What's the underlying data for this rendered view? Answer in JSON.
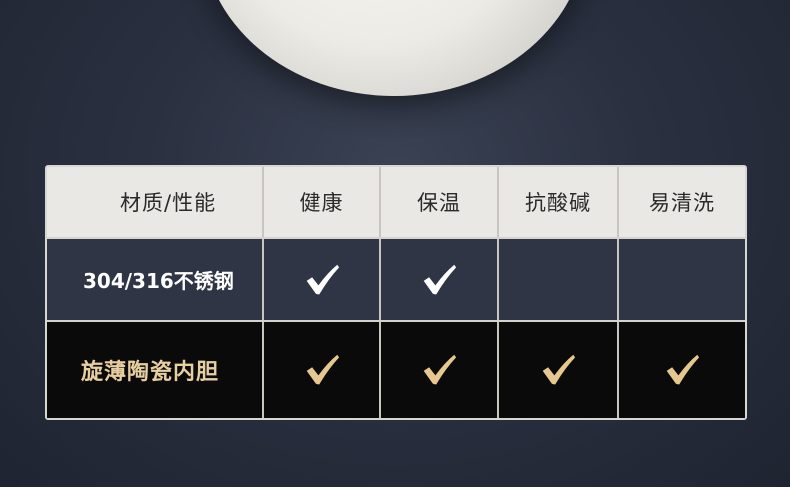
{
  "table": {
    "header": {
      "category": "材质/性能",
      "columns": [
        "健康",
        "保温",
        "抗酸碱",
        "易清洗"
      ]
    },
    "rows": [
      {
        "label": "304/316不锈钢",
        "checks": [
          true,
          true,
          false,
          false
        ],
        "check_color": "#ffffff"
      },
      {
        "label": "旋薄陶瓷内胆",
        "checks": [
          true,
          true,
          true,
          true
        ],
        "check_color": "#e6c88e"
      }
    ]
  },
  "colors": {
    "background": "#2a3040",
    "header_bg": "#e9e8e5",
    "steel_row_bg": "#2f3544",
    "ceramic_row_bg": "#0a0a0b",
    "gold_text": "#e8cfa0"
  },
  "icons": {
    "check": "check-icon",
    "bowl": "ceramic-bowl-image"
  }
}
